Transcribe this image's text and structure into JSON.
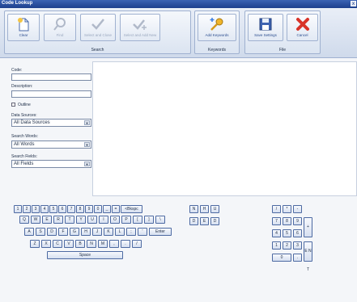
{
  "window": {
    "title": "Code Lookup",
    "close_glyph": "x"
  },
  "ribbon": {
    "groups": [
      {
        "label": "Search"
      },
      {
        "label": "Keywords"
      },
      {
        "label": "File"
      }
    ],
    "buttons": {
      "clear": "Clear",
      "find": "Find",
      "select_close": "Select and Close",
      "select_add_new": "Select and Add New",
      "add_keywords": "Add Keywords",
      "save_settings": "Save Settings",
      "cancel": "Cancel"
    }
  },
  "form": {
    "code_label": "Code:",
    "code_value": "",
    "description_label": "Description:",
    "description_value": "",
    "outline_label": "Outline",
    "data_sources_label": "Data Sources:",
    "data_sources_value": "All Data Sources",
    "search_words_label": "Search Words:",
    "search_words_value": "All Words",
    "search_fields_label": "Search Fields:",
    "search_fields_value": "All Fields"
  },
  "keyboard": {
    "row1": [
      "1",
      "2",
      "3",
      "4",
      "5",
      "6",
      "7",
      "8",
      "9",
      "0",
      "_",
      "=",
      "<Bkspc"
    ],
    "row2": [
      "Q",
      "W",
      "E",
      "R",
      "T",
      "Y",
      "U",
      "I",
      "O",
      "P",
      "[",
      "]",
      "\\"
    ],
    "row3": [
      "A",
      "S",
      "D",
      "F",
      "G",
      "H",
      "J",
      "K",
      "L",
      ";",
      "'",
      "Enter"
    ],
    "row4": [
      "Z",
      "X",
      "C",
      "V",
      "B",
      "N",
      "M",
      ",",
      ".",
      "/"
    ],
    "space": "Space",
    "extra_top": [
      "N",
      "H",
      "U"
    ],
    "extra_bottom": [
      "D",
      "E",
      "D"
    ],
    "numpad": {
      "row1": [
        "/",
        "*",
        "-"
      ],
      "row2": [
        "7",
        "8",
        "9"
      ],
      "row3": [
        "4",
        "5",
        "6"
      ],
      "row4": [
        "1",
        "2",
        "3"
      ],
      "row5": [
        "0",
        "."
      ],
      "plus": "+",
      "enter": "E N T"
    }
  },
  "colors": {
    "titlebar": "#1c3f8d",
    "accent": "#2b4d8f"
  },
  "icons": {
    "clear": "new-document-icon",
    "find": "magnifier-icon",
    "select_close": "checkmark-icon",
    "select_add_new": "checkmark-plus-icon",
    "add_keywords": "key-plus-icon",
    "save_settings": "floppy-disk-icon",
    "cancel": "red-x-icon"
  }
}
